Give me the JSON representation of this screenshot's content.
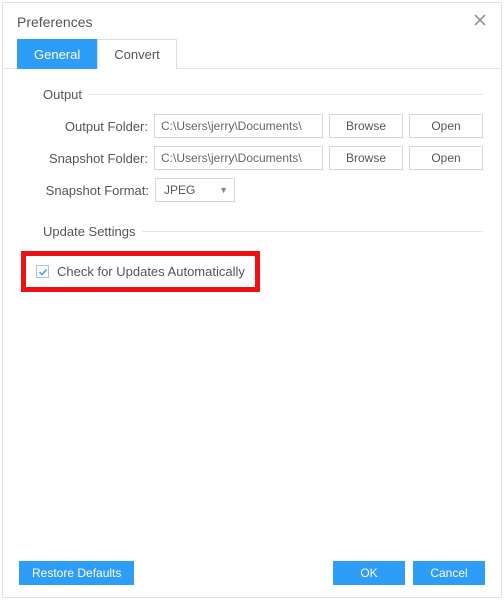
{
  "title": "Preferences",
  "tabs": {
    "general": "General",
    "convert": "Convert"
  },
  "output": {
    "section": "Output",
    "output_folder_label": "Output Folder:",
    "output_folder_value": "C:\\Users\\jerry\\Documents\\",
    "snapshot_folder_label": "Snapshot Folder:",
    "snapshot_folder_value": "C:\\Users\\jerry\\Documents\\",
    "snapshot_format_label": "Snapshot Format:",
    "snapshot_format_value": "JPEG",
    "browse": "Browse",
    "open": "Open"
  },
  "update": {
    "section": "Update Settings",
    "auto_check": "Check for Updates Automatically",
    "auto_check_checked": true
  },
  "footer": {
    "restore": "Restore Defaults",
    "ok": "OK",
    "cancel": "Cancel"
  }
}
